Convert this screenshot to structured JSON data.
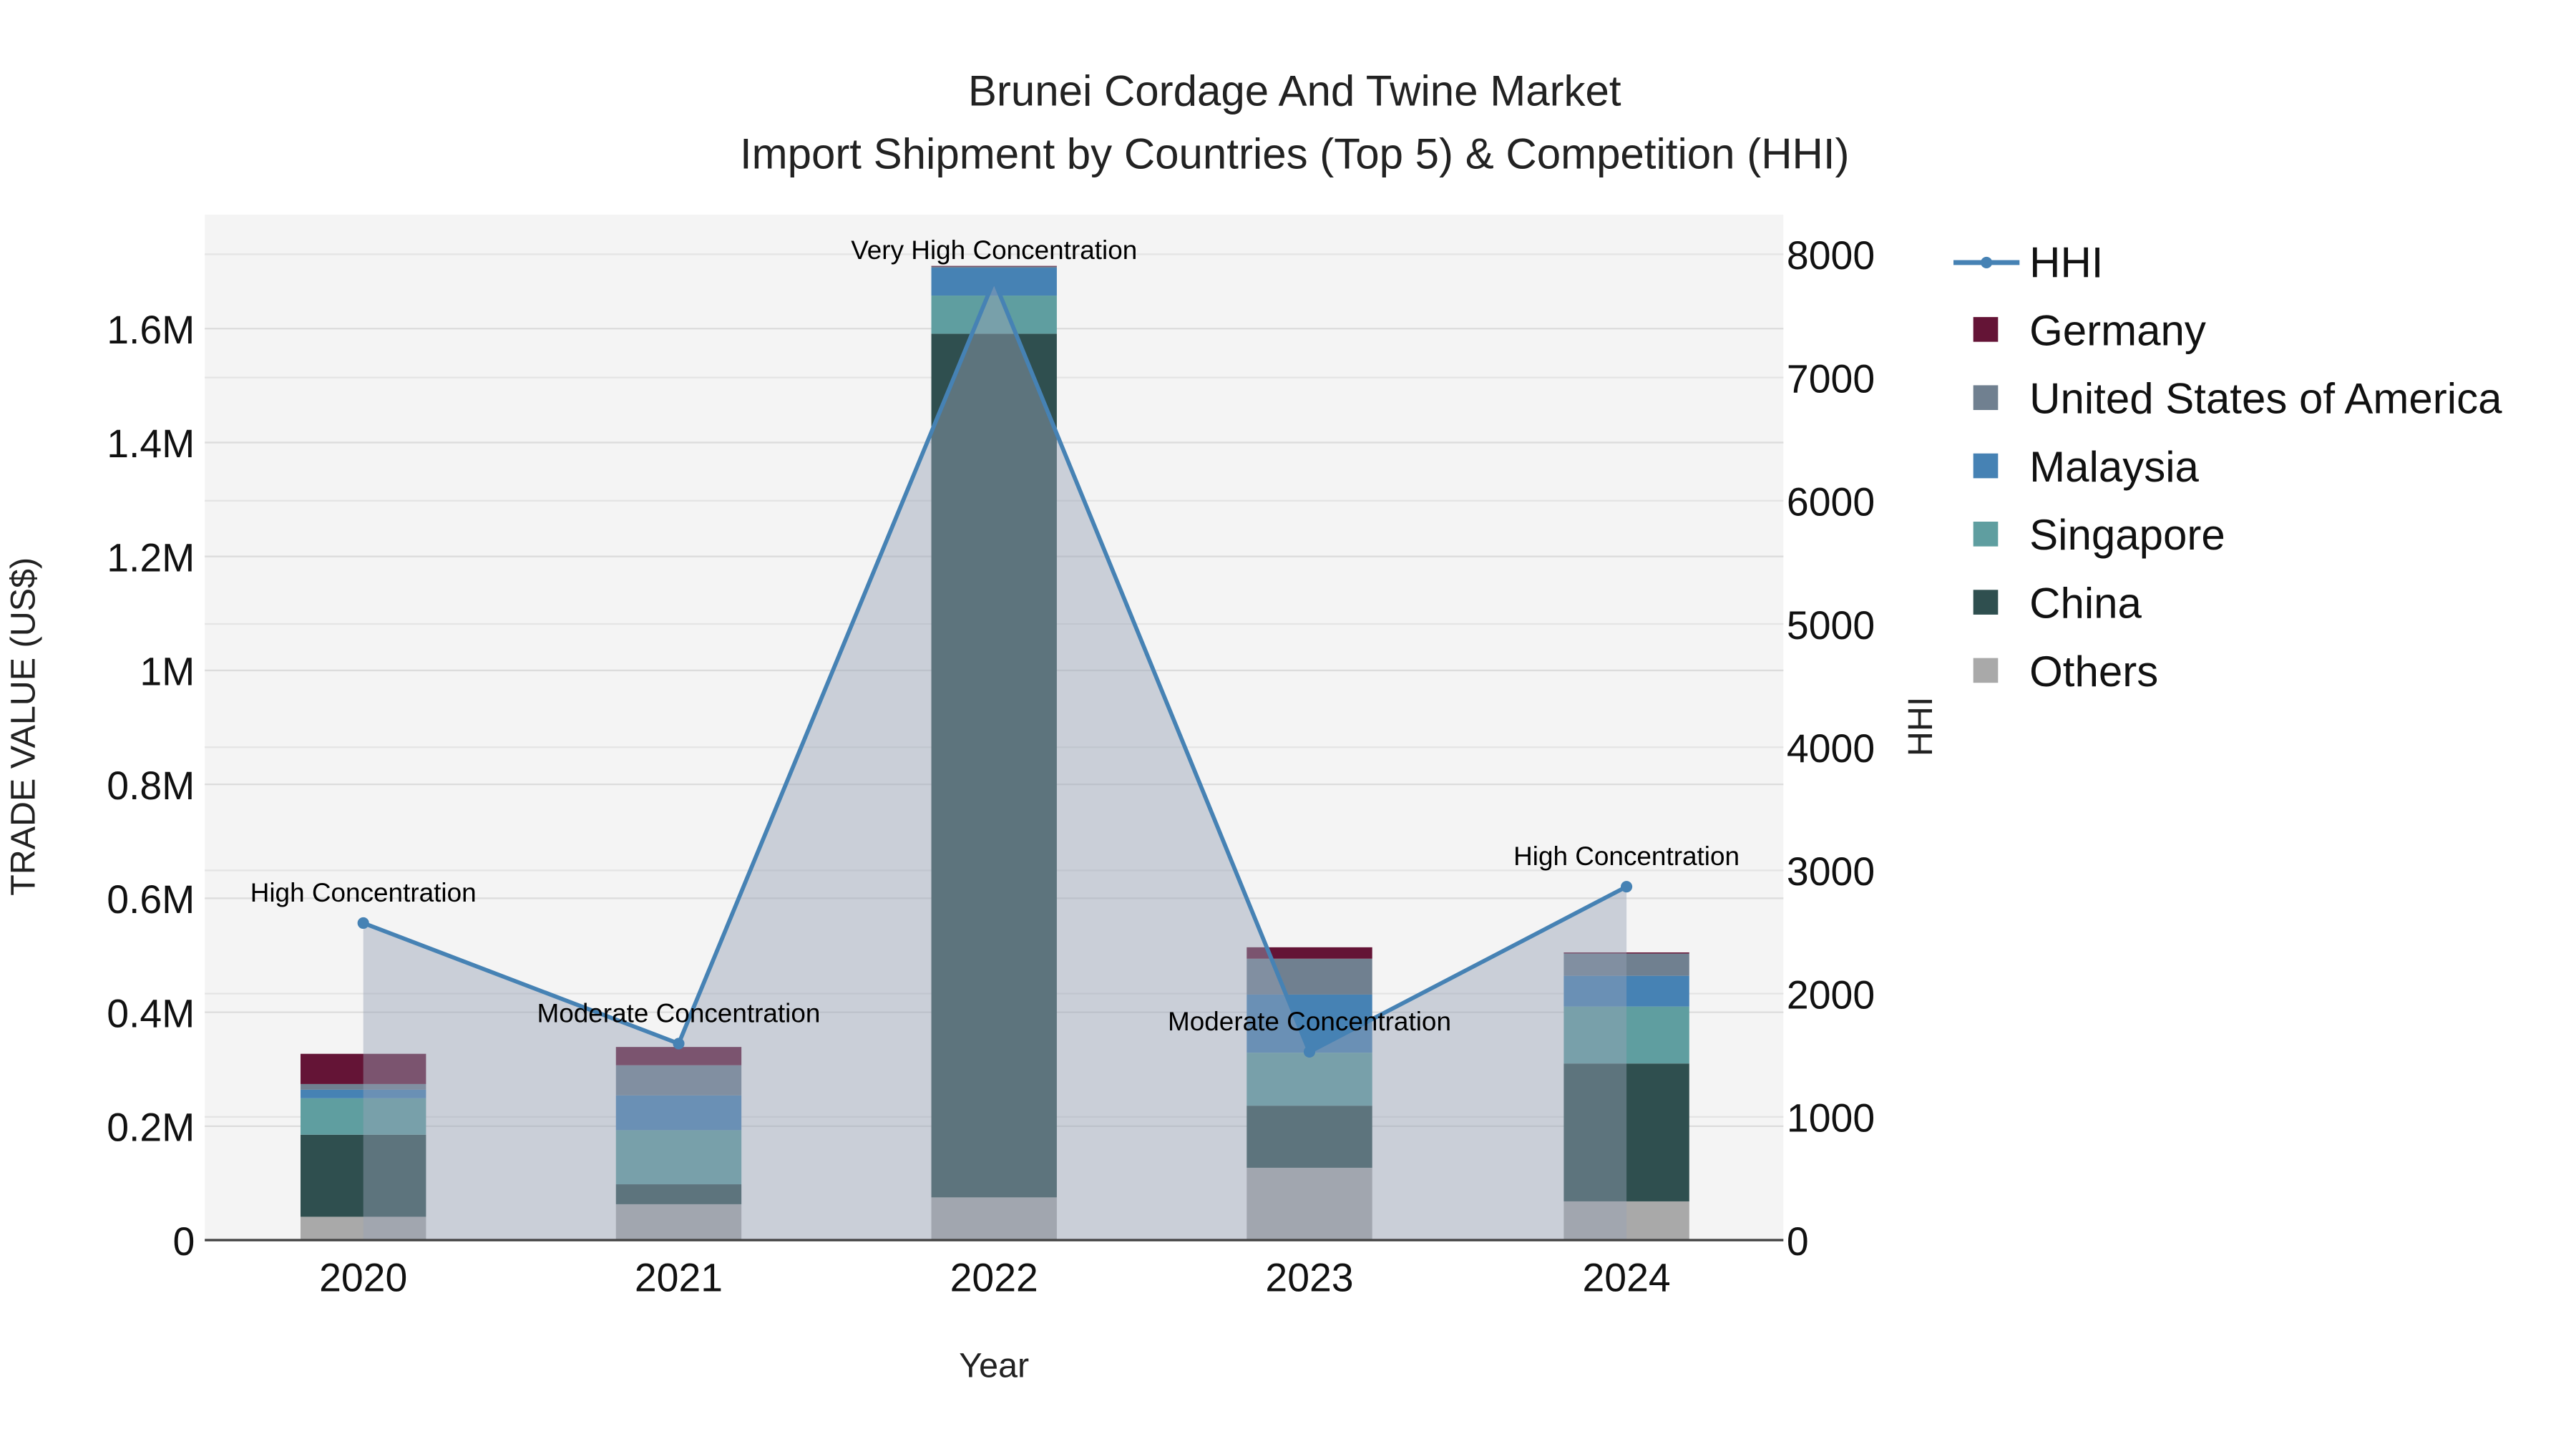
{
  "chart_data": {
    "type": "bar",
    "title": "Brunei Cordage And Twine Market",
    "subtitle": "Import Shipment by Countries (Top 5) & Competition (HHI)",
    "xlabel": "Year",
    "ylabel": "TRADE VALUE (US$)",
    "y2label": "HHI",
    "categories": [
      "2020",
      "2021",
      "2022",
      "2023",
      "2024"
    ],
    "ylim": [
      0,
      1800000
    ],
    "y2lim": [
      0,
      8300
    ],
    "yticks": [
      {
        "value": 0,
        "label": "0"
      },
      {
        "value": 200000,
        "label": "0.2M"
      },
      {
        "value": 400000,
        "label": "0.4M"
      },
      {
        "value": 600000,
        "label": "0.6M"
      },
      {
        "value": 800000,
        "label": "0.8M"
      },
      {
        "value": 1000000,
        "label": "1M"
      },
      {
        "value": 1200000,
        "label": "1.2M"
      },
      {
        "value": 1400000,
        "label": "1.4M"
      },
      {
        "value": 1600000,
        "label": "1.6M"
      }
    ],
    "y2ticks": [
      {
        "value": 0,
        "label": "0"
      },
      {
        "value": 1000,
        "label": "1000"
      },
      {
        "value": 2000,
        "label": "2000"
      },
      {
        "value": 3000,
        "label": "3000"
      },
      {
        "value": 4000,
        "label": "4000"
      },
      {
        "value": 5000,
        "label": "5000"
      },
      {
        "value": 6000,
        "label": "6000"
      },
      {
        "value": 7000,
        "label": "7000"
      },
      {
        "value": 8000,
        "label": "8000"
      }
    ],
    "grid": true,
    "legend_position": "right",
    "series": [
      {
        "name": "Others",
        "color": "#a9a9a9",
        "values": [
          41000,
          63000,
          75000,
          127000,
          68000
        ]
      },
      {
        "name": "China",
        "color": "#2f4f4f",
        "values": [
          144000,
          35000,
          1516000,
          109000,
          242000
        ]
      },
      {
        "name": "Singapore",
        "color": "#5f9ea0",
        "values": [
          64000,
          95000,
          67000,
          93000,
          100000
        ]
      },
      {
        "name": "Malaysia",
        "color": "#4682b4",
        "values": [
          15000,
          61000,
          49000,
          102000,
          54000
        ]
      },
      {
        "name": "United States of America",
        "color": "#708090",
        "values": [
          10000,
          53000,
          2000,
          63000,
          39000
        ]
      },
      {
        "name": "Germany",
        "color": "#641436",
        "values": [
          53000,
          32000,
          1000,
          20000,
          2000
        ]
      }
    ],
    "legend_order": [
      "HHI",
      "Germany",
      "United States of America",
      "Malaysia",
      "Singapore",
      "China",
      "Others"
    ],
    "hhi": {
      "name": "HHI",
      "color": "#4682b4",
      "values": [
        2573,
        1595,
        7788,
        1528,
        2868
      ],
      "annotations": [
        "High Concentration",
        "Moderate Concentration",
        "Very High Concentration",
        "Moderate Concentration",
        "High Concentration"
      ]
    }
  }
}
